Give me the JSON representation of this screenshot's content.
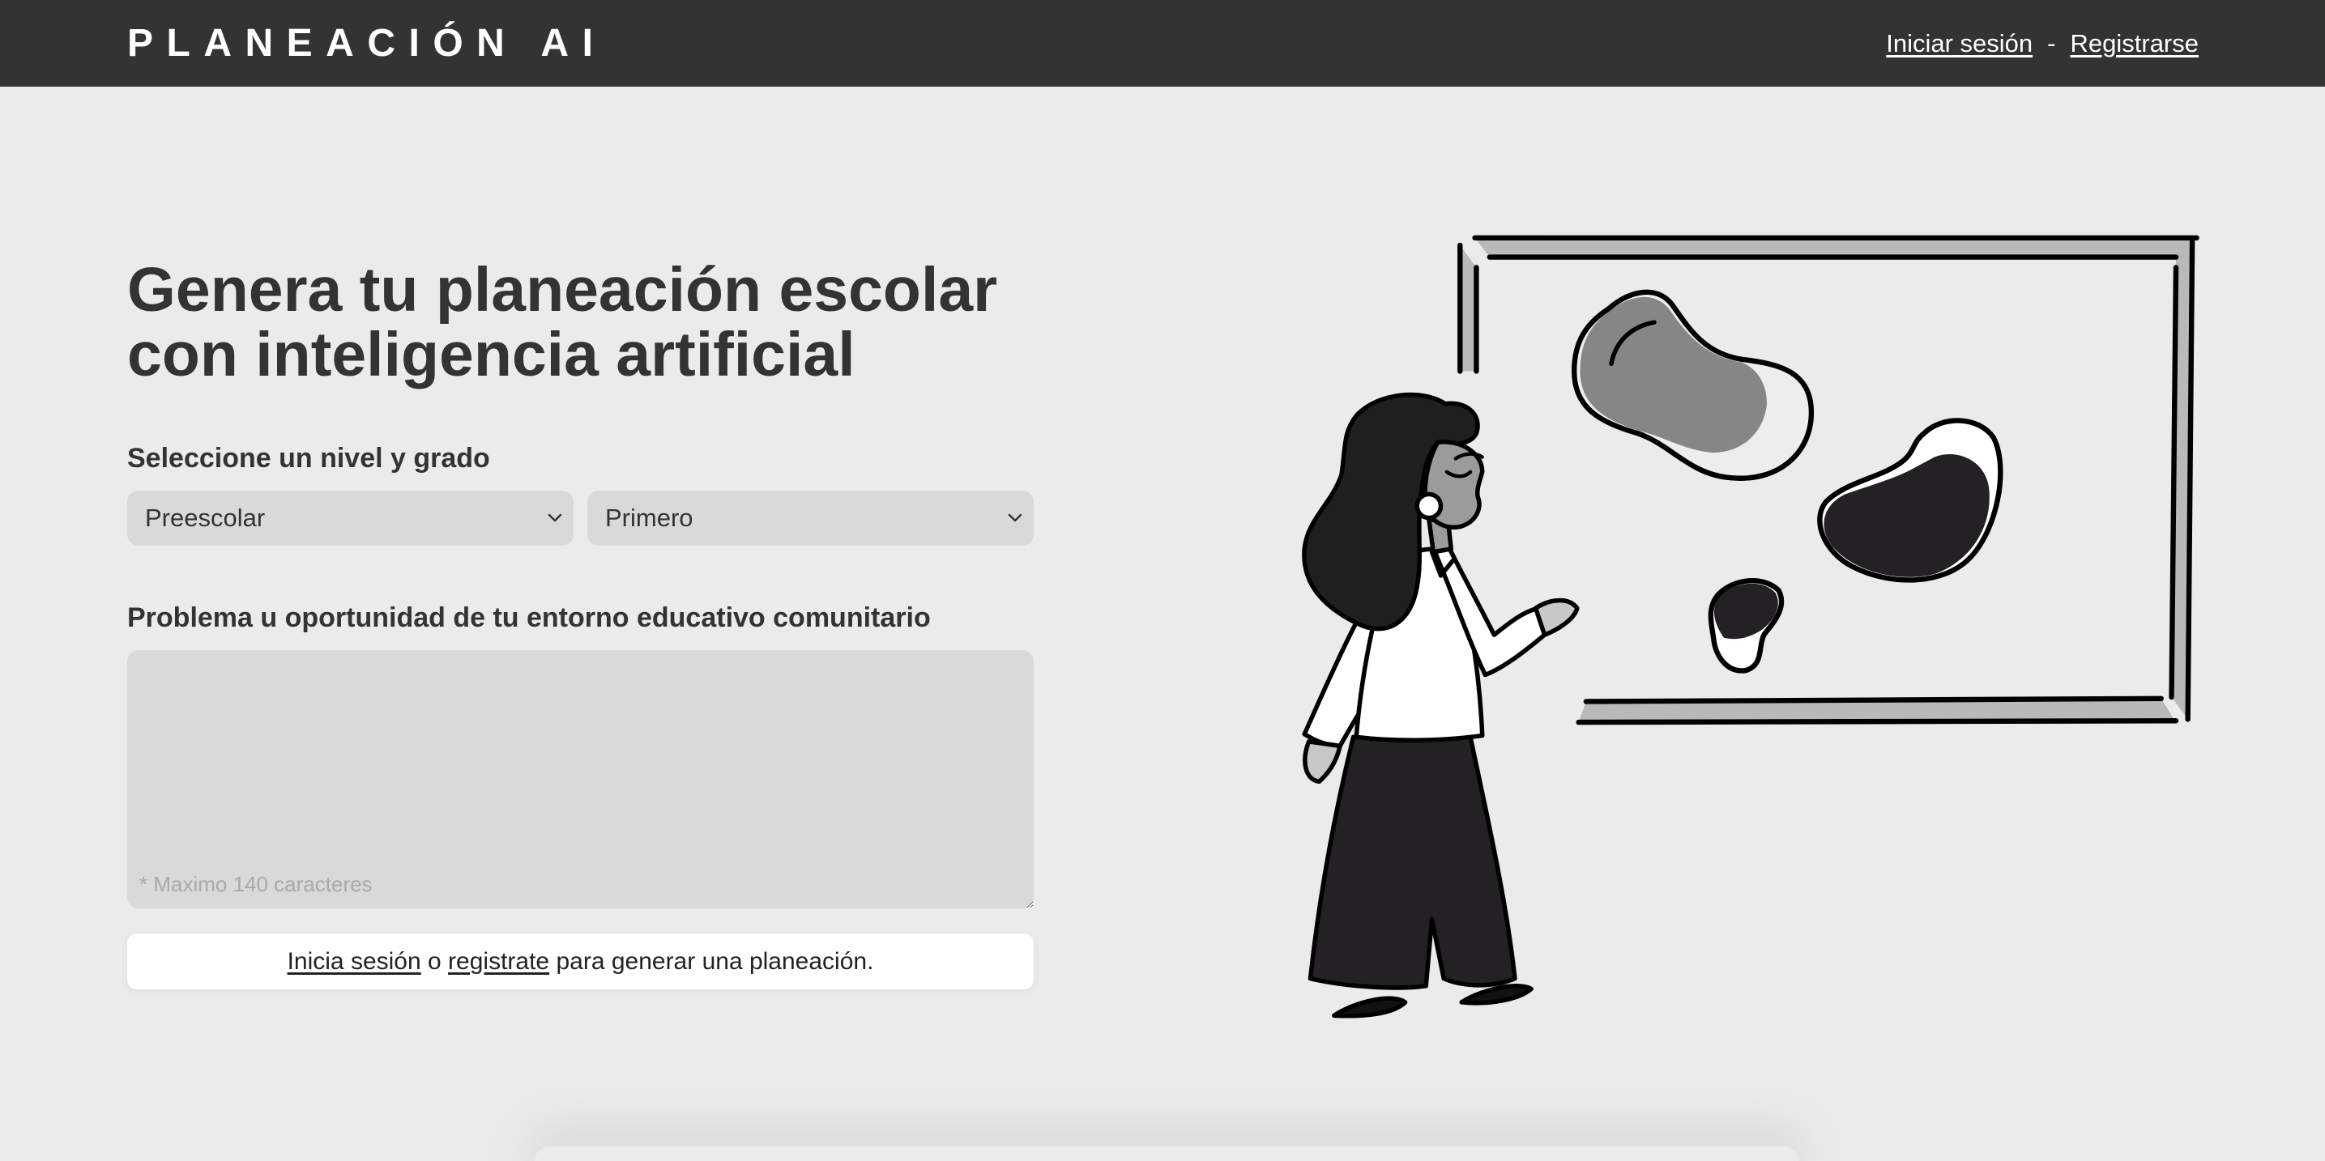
{
  "header": {
    "logo": "PLANEACIÓN AI",
    "login_link": "Iniciar sesión",
    "separator": "-",
    "register_link": "Registrarse"
  },
  "hero": {
    "title_line1": "Genera tu planeación escolar",
    "title_line2": "con inteligencia artificial"
  },
  "form": {
    "level_label": "Seleccione un nivel y grado",
    "level_select": {
      "selected": "Preescolar",
      "icon": "chevron-down-icon"
    },
    "grade_select": {
      "selected": "Primero",
      "icon": "chevron-down-icon"
    },
    "problem_label": "Problema u oportunidad de tu entorno educativo comunitario",
    "problem_textarea": {
      "value": "",
      "hint": "* Maximo 140 caracteres"
    },
    "notice": {
      "login_link": "Inicia sesión",
      "connector": "o",
      "register_link": "registrate",
      "suffix": "para generar una planeación."
    }
  },
  "colors": {
    "header_bg": "#333333",
    "page_bg": "#ebebeb",
    "field_bg": "#d9d9d9",
    "text": "#333333",
    "notice_bg": "#ffffff"
  }
}
